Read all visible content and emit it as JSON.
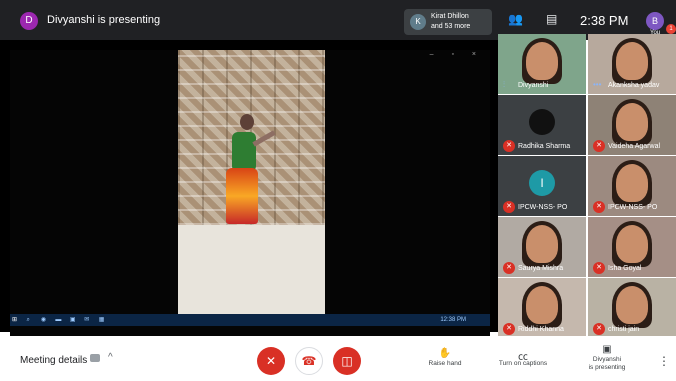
{
  "topbar": {
    "presenter_initial": "D",
    "presenter_title": "Divyanshi is presenting",
    "others_initial": "K",
    "others_line1": "Kirat Dhillon",
    "others_line2": "and 53 more",
    "clock": "2:38 PM",
    "you_initial": "B",
    "you_label": "You",
    "notification_count": "1"
  },
  "shared_screen": {
    "window_controls": "– ▫ ×",
    "taskbar_time": "12:38 PM"
  },
  "participants": [
    {
      "name": "Divyanshi",
      "status": "speaking",
      "type": "video"
    },
    {
      "name": "Akanksha yadav",
      "status": "speaking",
      "type": "video"
    },
    {
      "name": "Radhika Sharma",
      "status": "muted",
      "type": "initial",
      "initial": "",
      "color": "#111111"
    },
    {
      "name": "Vaideha Agarwal",
      "status": "muted",
      "type": "video"
    },
    {
      "name": "IPCW-NSS- PO",
      "status": "muted",
      "type": "initial",
      "initial": "I",
      "color": "#1e9aa6"
    },
    {
      "name": "IPCW-NSS- PO",
      "status": "muted",
      "type": "video"
    },
    {
      "name": "Saurya Mishra",
      "status": "muted",
      "type": "video"
    },
    {
      "name": "Isha Goyal",
      "status": "muted",
      "type": "video"
    },
    {
      "name": "Riddhi Khanna",
      "status": "muted",
      "type": "video"
    },
    {
      "name": "christi jain",
      "status": "muted",
      "type": "video"
    }
  ],
  "bottombar": {
    "meeting_details": "Meeting details",
    "raise_hand": "Raise hand",
    "captions": "Turn on captions",
    "presenting_line1": "Divyanshi",
    "presenting_line2": "is presenting"
  },
  "icons": {
    "mic_off": "mic-off-icon",
    "end_call": "phone-hangup-icon",
    "camera_off": "camera-off-icon",
    "hand": "hand-icon",
    "captions": "cc-icon",
    "present": "present-icon",
    "more": "more-vert-icon"
  },
  "colors": {
    "danger": "#d93025",
    "dark_bar": "#202124"
  }
}
